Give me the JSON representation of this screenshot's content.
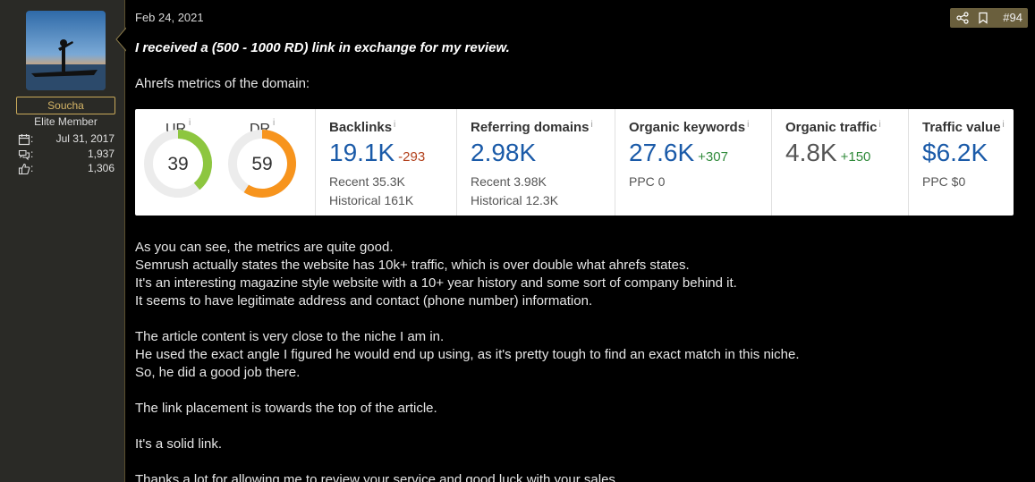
{
  "user": {
    "name": "Soucha",
    "title": "Elite Member",
    "stats": [
      {
        "icon": "calendar-icon",
        "value": "Jul 31, 2017"
      },
      {
        "icon": "messages-icon",
        "value": "1,937"
      },
      {
        "icon": "thumbs-up-icon",
        "value": "1,306"
      }
    ]
  },
  "post": {
    "date": "Feb 24, 2021",
    "number": "#94",
    "lead": "I received a (500 - 1000 RD) link in exchange for my review.",
    "subhead": "Ahrefs metrics of the domain:",
    "paragraphs": [
      [
        "As you can see, the metrics are quite good.",
        "Semrush actually states the website has 10k+ traffic, which is over double what ahrefs states.",
        "It's an interesting magazine style website with a 10+ year history and some sort of company behind it.",
        "It seems to have legitimate address and contact (phone number) information."
      ],
      [
        "The article content is very close to the niche I am in.",
        "He used the exact angle I figured he would end up using, as it's pretty tough to find an exact match in this niche.",
        "So, he did a good job there."
      ],
      [
        "The link placement is towards the top of the article."
      ],
      [
        "It's a solid link."
      ],
      [
        "Thanks a lot for allowing me to review your service and good luck with your sales."
      ]
    ]
  },
  "metrics": {
    "info_glyph": "i",
    "ur": {
      "label": "UR",
      "value": "39",
      "fraction": 0.39,
      "color": "#8dc63f"
    },
    "dr": {
      "label": "DR",
      "value": "59",
      "fraction": 0.59,
      "color": "#f7941d"
    },
    "backlinks": {
      "title": "Backlinks",
      "value": "19.1K",
      "delta": "-293",
      "recent": "Recent 35.3K",
      "historical": "Historical 161K"
    },
    "refdomains": {
      "title": "Referring domains",
      "value": "2.98K",
      "recent": "Recent 3.98K",
      "historical": "Historical 12.3K"
    },
    "keywords": {
      "title": "Organic keywords",
      "value": "27.6K",
      "delta": "+307",
      "ppc": "PPC 0"
    },
    "traffic": {
      "title": "Organic traffic",
      "value": "4.8K",
      "delta": "+150"
    },
    "trafficvalue": {
      "title": "Traffic value",
      "value": "$6.2K",
      "ppc": "PPC $0"
    }
  },
  "colors": {
    "accent_gold": "#d4b466",
    "action_bar": "#6a5f3d",
    "link_blue": "#1a5aa8"
  }
}
